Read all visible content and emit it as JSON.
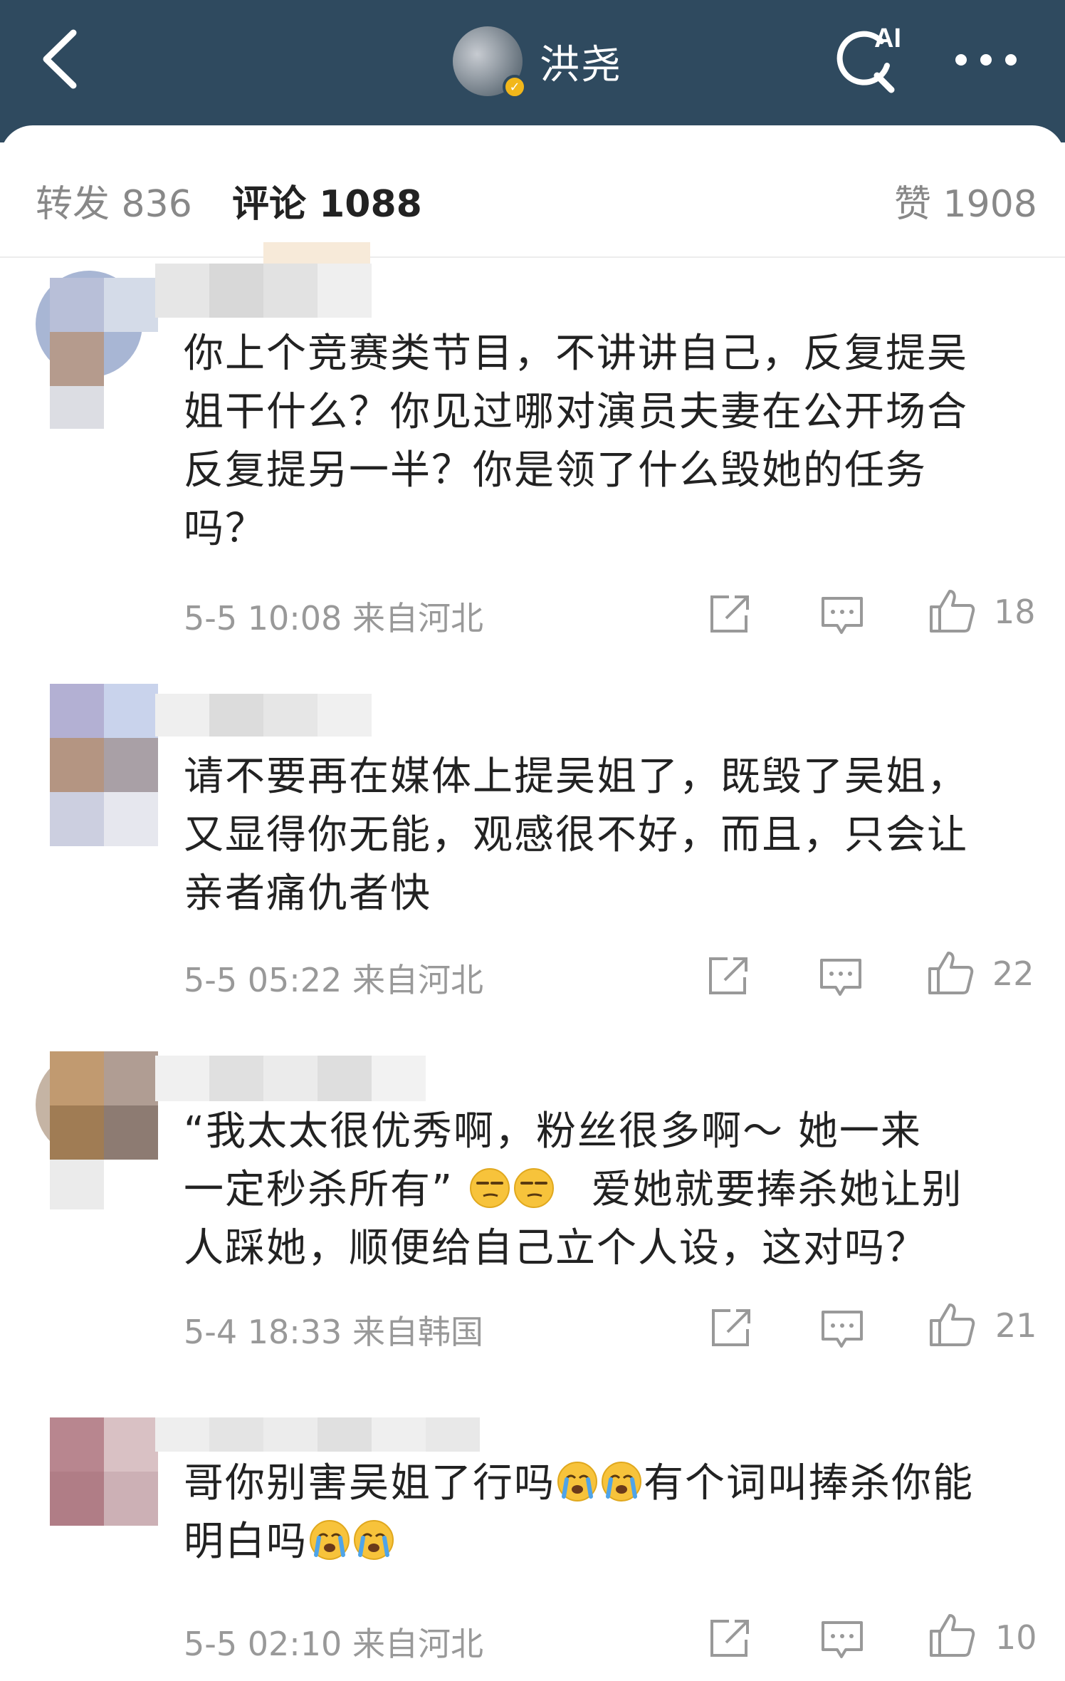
{
  "header": {
    "title": "洪尧",
    "ai_label": "AI",
    "icons": {
      "back": "chevron-left-icon",
      "ai_search": "ai-search-icon",
      "more": "more-icon",
      "verified": "verified-badge-icon"
    },
    "bg_color": "#2f4a5f"
  },
  "stats": {
    "repost": "转发 836",
    "comments": "评论 1088",
    "likes": "赞 1908"
  },
  "comments": [
    {
      "lines": [
        "你上个竞赛类节目，不讲讲自己，反复提吴",
        "姐干什么？你见过哪对演员夫妻在公开场合",
        "反复提另一半？你是领了什么毁她的任务",
        "吗？"
      ],
      "meta": "5-5 10:08 来自河北",
      "likes": "18"
    },
    {
      "lines": [
        "请不要再在媒体上提吴姐了，既毁了吴姐，",
        "又显得你无能，观感很不好，而且，只会让",
        "亲者痛仇者快"
      ],
      "meta": "5-5 05:22 来自河北",
      "likes": "22"
    },
    {
      "line1": "“我太太很优秀啊，粉丝很多啊～ 她一来",
      "line2a": "一定秒杀所有”",
      "line2b": "爱她就要捧杀她让别",
      "line3": "人踩她，顺便给自己立个人设，这对吗？",
      "emoji": "smirk-emoji",
      "meta": "5-4 18:33 来自韩国",
      "likes": "21"
    },
    {
      "line1a": "哥你别害吴姐了行吗",
      "line1b": "有个词叫捧杀你能",
      "line2": "明白吗",
      "emoji": "crying-emoji",
      "meta": "5-5 02:10 来自河北",
      "likes": "10"
    }
  ],
  "action_icons": [
    "share-icon",
    "reply-icon",
    "thumbs-up-icon"
  ]
}
